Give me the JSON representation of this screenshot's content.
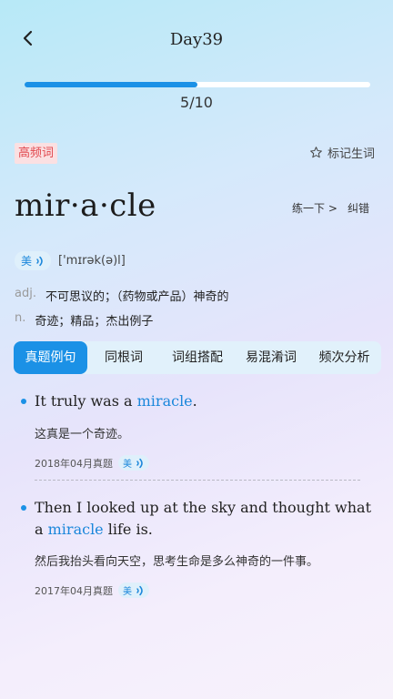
{
  "header": {
    "title": "Day39"
  },
  "progress": {
    "current": 5,
    "total": 10,
    "label": "5/10"
  },
  "word": {
    "frequency_badge": "高频词",
    "mark_label": "标记生词",
    "text": "mir·a·cle",
    "practice_label": "练一下 >",
    "correct_label": "纠错",
    "accent": "美",
    "phonetic": "['mɪrək(ə)l]",
    "definitions": [
      {
        "pos": "adj.",
        "meaning": "不可思议的；（药物或产品）神奇的"
      },
      {
        "pos": "n.",
        "meaning": "奇迹；精品；杰出例子"
      }
    ]
  },
  "tabs": [
    {
      "label": "真题例句",
      "active": true
    },
    {
      "label": "同根词",
      "active": false
    },
    {
      "label": "词组搭配",
      "active": false
    },
    {
      "label": "易混淆词",
      "active": false
    },
    {
      "label": "频次分析",
      "active": false
    }
  ],
  "examples": [
    {
      "en_before": "It truly was a ",
      "keyword": "miracle",
      "en_after": ".",
      "zh": "这真是一个奇迹。",
      "source": "2018年04月真题",
      "accent": "美"
    },
    {
      "en_before": "Then I looked up at the sky and thought what a ",
      "keyword": "miracle",
      "en_after": " life is.",
      "zh": "然后我抬头看向天空，思考生命是多么神奇的一件事。",
      "source": "2017年04月真题",
      "accent": "美"
    }
  ],
  "colors": {
    "accent": "#1b91e6",
    "badge_bg": "#fbe0e2",
    "badge_text": "#e1484e"
  },
  "icons": {
    "back": "chevron-left-icon",
    "star": "star-outline-icon",
    "sound": "sound-wave-icon"
  }
}
